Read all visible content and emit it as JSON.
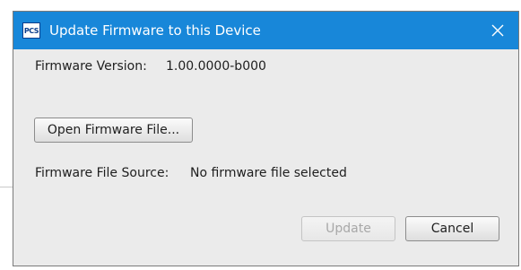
{
  "dialog": {
    "title": "Update Firmware to this Device",
    "app_icon_text": "PCS",
    "close_glyph": "✕"
  },
  "firmware_version": {
    "label": "Firmware Version:",
    "value": "1.00.0000-b000"
  },
  "open_button_label": "Open Firmware File...",
  "file_source": {
    "label": "Firmware File Source:",
    "value": "No firmware file selected"
  },
  "buttons": {
    "update_label": "Update",
    "update_disabled": true,
    "cancel_label": "Cancel"
  },
  "colors": {
    "titlebar": "#1887d9",
    "dialog_bg": "#ebebeb"
  }
}
